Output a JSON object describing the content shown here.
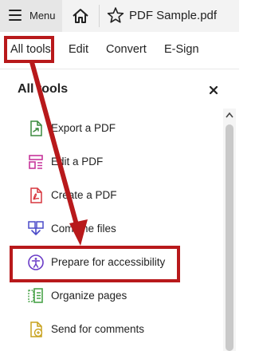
{
  "topbar": {
    "menu_label": "Menu",
    "document_title": "PDF Sample.pdf"
  },
  "tabs": [
    {
      "label": "All tools"
    },
    {
      "label": "Edit"
    },
    {
      "label": "Convert"
    },
    {
      "label": "E-Sign"
    }
  ],
  "panel": {
    "title": "All tools",
    "items": [
      {
        "label": "Export a PDF",
        "icon": "export-pdf-icon"
      },
      {
        "label": "Edit a PDF",
        "icon": "edit-pdf-icon"
      },
      {
        "label": "Create a PDF",
        "icon": "create-pdf-icon"
      },
      {
        "label": "Combine files",
        "icon": "combine-files-icon"
      },
      {
        "label": "Prepare for accessibility",
        "icon": "accessibility-icon"
      },
      {
        "label": "Organize pages",
        "icon": "organize-pages-icon"
      },
      {
        "label": "Send for comments",
        "icon": "send-comments-icon"
      }
    ]
  },
  "annotation": {
    "color": "#b8191b"
  }
}
